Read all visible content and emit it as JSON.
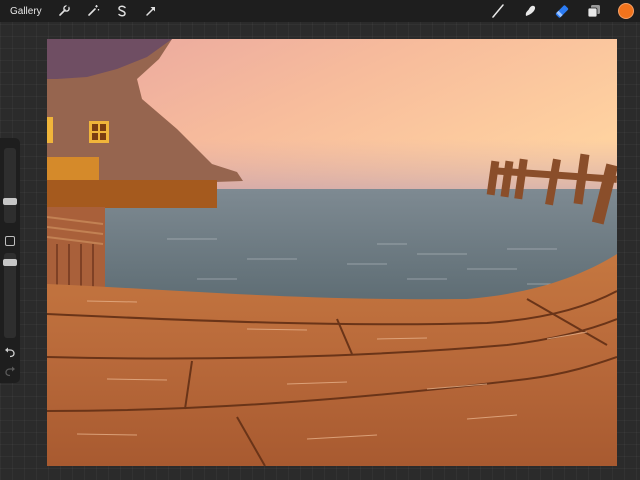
{
  "toolbar": {
    "gallery_label": "Gallery",
    "left_tools": [
      "wrench-icon",
      "magic-wand-icon",
      "selection-s-icon",
      "transform-arrow-icon"
    ],
    "right_tools": [
      "brush-icon",
      "smudge-icon",
      "eraser-icon",
      "layers-icon"
    ],
    "active_tool": "eraser",
    "active_color": "#f2731c",
    "accent_color": "#2b7bf3"
  },
  "sidebar": {
    "brush_size_level": 0.35,
    "opacity_level": 0.3,
    "modify_button": "square-icon",
    "undo": "undo-icon",
    "redo": "redo-icon"
  },
  "canvas": {
    "content": "painting-icon"
  }
}
